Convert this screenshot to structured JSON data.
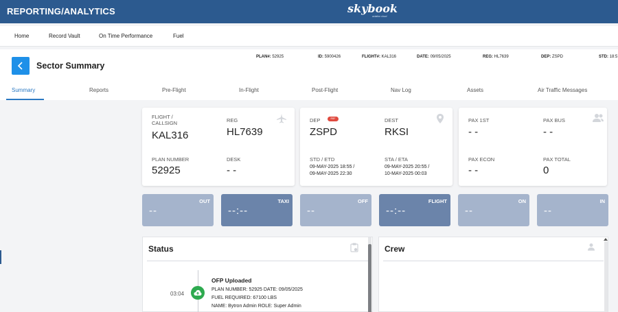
{
  "app": {
    "title": "REPORTING/ANALYTICS",
    "logo_text": "skybook",
    "logo_subtext": "aviation cloud"
  },
  "nav": {
    "items": [
      "Home",
      "Record Vault",
      "On Time Performance",
      "Fuel"
    ]
  },
  "page": {
    "title": "Sector Summary"
  },
  "meta": [
    {
      "label": "PLAN#:",
      "value": "52925"
    },
    {
      "label": "ID:",
      "value": "5900426"
    },
    {
      "label": "FLIGHT#:",
      "value": "KAL316"
    },
    {
      "label": "DATE:",
      "value": "09/05/2025"
    },
    {
      "label": "REG:",
      "value": "HL7639"
    },
    {
      "label": "DEP:",
      "value": "ZSPD"
    },
    {
      "label": "STD:",
      "value": "18:5"
    }
  ],
  "tabs": [
    "Summary",
    "Reports",
    "Pre-Flight",
    "In-Flight",
    "Post-Flight",
    "Nav Log",
    "Assets",
    "Air Traffic Messages"
  ],
  "flight_card": {
    "callsign_label": "FLIGHT /\nCALLSIGN",
    "callsign": "KAL316",
    "reg_label": "REG",
    "reg": "HL7639",
    "plan_label": "PLAN NUMBER",
    "plan": "52925",
    "desk_label": "DESK",
    "desk": "- -"
  },
  "route_card": {
    "dep_label": "DEP",
    "dep_badge": "RSF",
    "dep": "ZSPD",
    "dest_label": "DEST",
    "dest": "RKSI",
    "std_label": "STD / ETD",
    "std_line1": "09-MAY-2025 18:55 /",
    "std_line2": "09-MAY-2025 22:30",
    "sta_label": "STA / ETA",
    "sta_line1": "09-MAY-2025 20:55 /",
    "sta_line2": "10-MAY-2025 00:03"
  },
  "pax_card": {
    "pax1_label": "PAX 1ST",
    "pax1": "- -",
    "paxbus_label": "PAX BUS",
    "paxbus": "- -",
    "paxecon_label": "PAX ECON",
    "paxecon": "- -",
    "paxtotal_label": "PAX TOTAL",
    "paxtotal": "0"
  },
  "tiles": [
    {
      "label": "OUT",
      "value": "--",
      "style": "light"
    },
    {
      "label": "TAXI",
      "value": "--:--",
      "style": "dark"
    },
    {
      "label": "OFF",
      "value": "--",
      "style": "light"
    },
    {
      "label": "FLIGHT",
      "value": "--:--",
      "style": "dark"
    },
    {
      "label": "ON",
      "value": "--",
      "style": "light"
    },
    {
      "label": "IN",
      "value": "--",
      "style": "light"
    }
  ],
  "status_panel": {
    "title": "Status",
    "event": {
      "time": "03:04",
      "title": "OFP Uploaded",
      "line1": "PLAN NUMBER: 52925 DATE: 09/05/2025",
      "line2": "FUEL REQUIRED: 67100 LBS",
      "line3": "NAME: Bytron Admin ROLE: Super Admin"
    }
  },
  "crew_panel": {
    "title": "Crew"
  },
  "colors": {
    "header": "#2c5a8f",
    "accent": "#1e90e8",
    "tab_active": "#2a78c2",
    "tile_light": "#a5b4cc",
    "tile_dark": "#6b84aa",
    "status_dot": "#2eaa4f"
  },
  "icons": [
    "chevron-left-icon",
    "plane-icon",
    "map-pin-icon",
    "users-icon",
    "clipboard-icon",
    "user-icon",
    "cloud-upload-icon"
  ]
}
